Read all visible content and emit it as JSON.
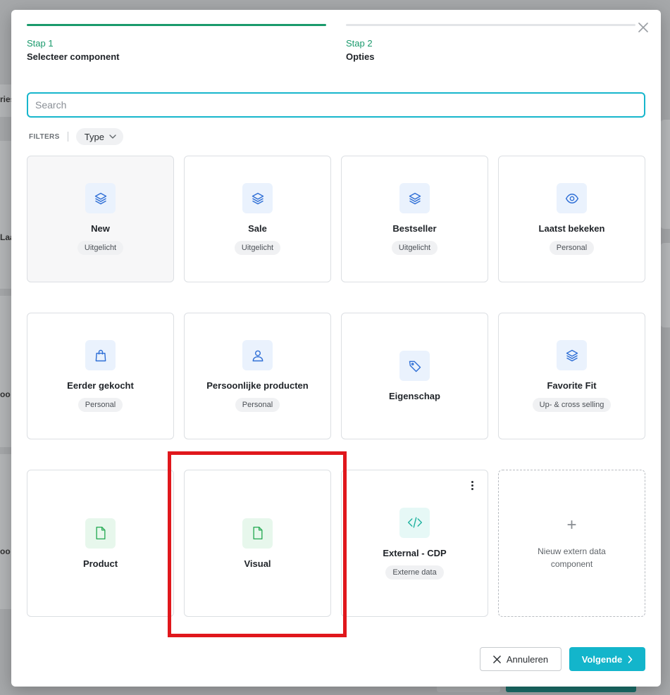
{
  "background": {
    "fragments": [
      "ries",
      "Laa",
      "oo",
      "oo"
    ]
  },
  "steps": [
    {
      "number": "Stap 1",
      "label": "Selecteer component",
      "active": true
    },
    {
      "number": "Stap 2",
      "label": "Opties",
      "active": false
    }
  ],
  "search": {
    "placeholder": "Search",
    "value": ""
  },
  "filters": {
    "label": "FILTERS",
    "type_label": "Type"
  },
  "cards": [
    {
      "title": "New",
      "tag": "Uitgelicht",
      "icon": "layers-icon",
      "color": "blue"
    },
    {
      "title": "Sale",
      "tag": "Uitgelicht",
      "icon": "layers-icon",
      "color": "blue"
    },
    {
      "title": "Bestseller",
      "tag": "Uitgelicht",
      "icon": "layers-icon",
      "color": "blue"
    },
    {
      "title": "Laatst bekeken",
      "tag": "Personal",
      "icon": "eye-icon",
      "color": "blue"
    },
    {
      "title": "Eerder gekocht",
      "tag": "Personal",
      "icon": "shopping-bag-icon",
      "color": "blue"
    },
    {
      "title": "Persoonlijke producten",
      "tag": "Personal",
      "icon": "user-icon",
      "color": "blue"
    },
    {
      "title": "Eigenschap",
      "tag": "",
      "icon": "tag-icon",
      "color": "blue"
    },
    {
      "title": "Favorite Fit",
      "tag": "Up- & cross selling",
      "icon": "layers-icon",
      "color": "blue"
    },
    {
      "title": "Product",
      "tag": "",
      "icon": "file-icon",
      "color": "green"
    },
    {
      "title": "Visual",
      "tag": "",
      "icon": "file-icon",
      "color": "green"
    },
    {
      "title": "External - CDP",
      "tag": "Externe data",
      "icon": "code-icon",
      "color": "teal"
    }
  ],
  "new_external": {
    "plus": "+",
    "label": "Nieuw extern data component"
  },
  "footer": {
    "cancel_label": "Annuleren",
    "next_label": "Volgende"
  },
  "colors": {
    "accent": "#13b5cb",
    "step_active": "#1a9a6c",
    "highlight": "#e0171c"
  }
}
